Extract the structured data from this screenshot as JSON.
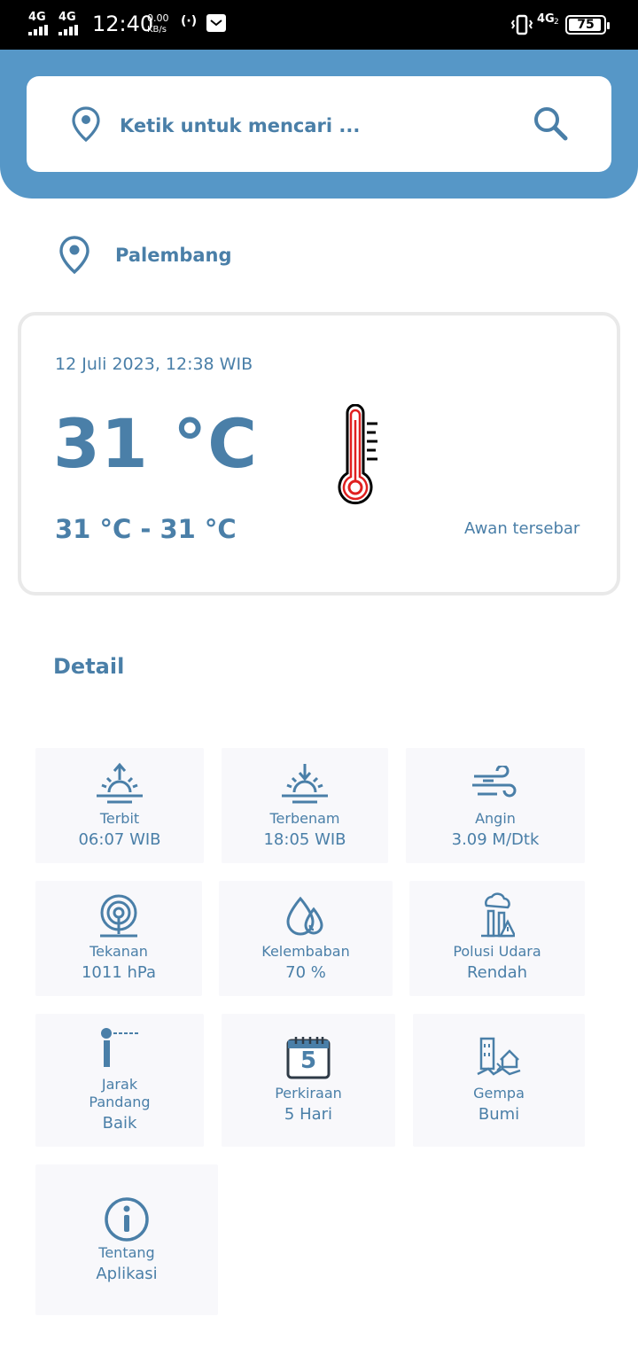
{
  "status_bar": {
    "network1": "4G",
    "network2": "4G",
    "time": "12:40",
    "speed_value": "0.00",
    "speed_unit": "KB/s",
    "network3": "4G",
    "network3_sub": "2",
    "battery": "75"
  },
  "search": {
    "placeholder": "Ketik untuk mencari ..."
  },
  "location": {
    "name": "Palembang"
  },
  "weather": {
    "datetime": "12 Juli 2023, 12:38 WIB",
    "temperature": "31 °C",
    "range": "31 °C - 31 °C",
    "description": "Awan tersebar"
  },
  "detail": {
    "title": "Detail",
    "tiles": [
      {
        "label": "Terbit",
        "value": "06:07 WIB",
        "icon": "sunrise-icon"
      },
      {
        "label": "Terbenam",
        "value": "18:05 WIB",
        "icon": "sunset-icon"
      },
      {
        "label": "Angin",
        "value": "3.09 M/Dtk",
        "icon": "wind-icon"
      },
      {
        "label": "Tekanan",
        "value": "1011 hPa",
        "icon": "pressure-icon"
      },
      {
        "label": "Kelembaban",
        "value": "70 %",
        "icon": "humidity-icon"
      },
      {
        "label": "Polusi Udara",
        "value": "Rendah",
        "icon": "air-pollution-icon"
      },
      {
        "label": "Jarak\nPandang",
        "label_line1": "Jarak",
        "label_line2": "Pandang",
        "value": "Baik",
        "icon": "visibility-icon"
      },
      {
        "label": "Perkiraan",
        "value": "5 Hari",
        "icon": "calendar-forecast-icon",
        "calendar_number": "5"
      },
      {
        "label": "Gempa",
        "value": "Bumi",
        "icon": "earthquake-icon"
      },
      {
        "label": "Tentang",
        "value": "Aplikasi",
        "icon": "info-icon"
      }
    ]
  },
  "colors": {
    "accent": "#5697c7",
    "text": "#4a7fa8",
    "tile_bg": "#f8f8fb",
    "thermometer_red": "#e02020"
  }
}
